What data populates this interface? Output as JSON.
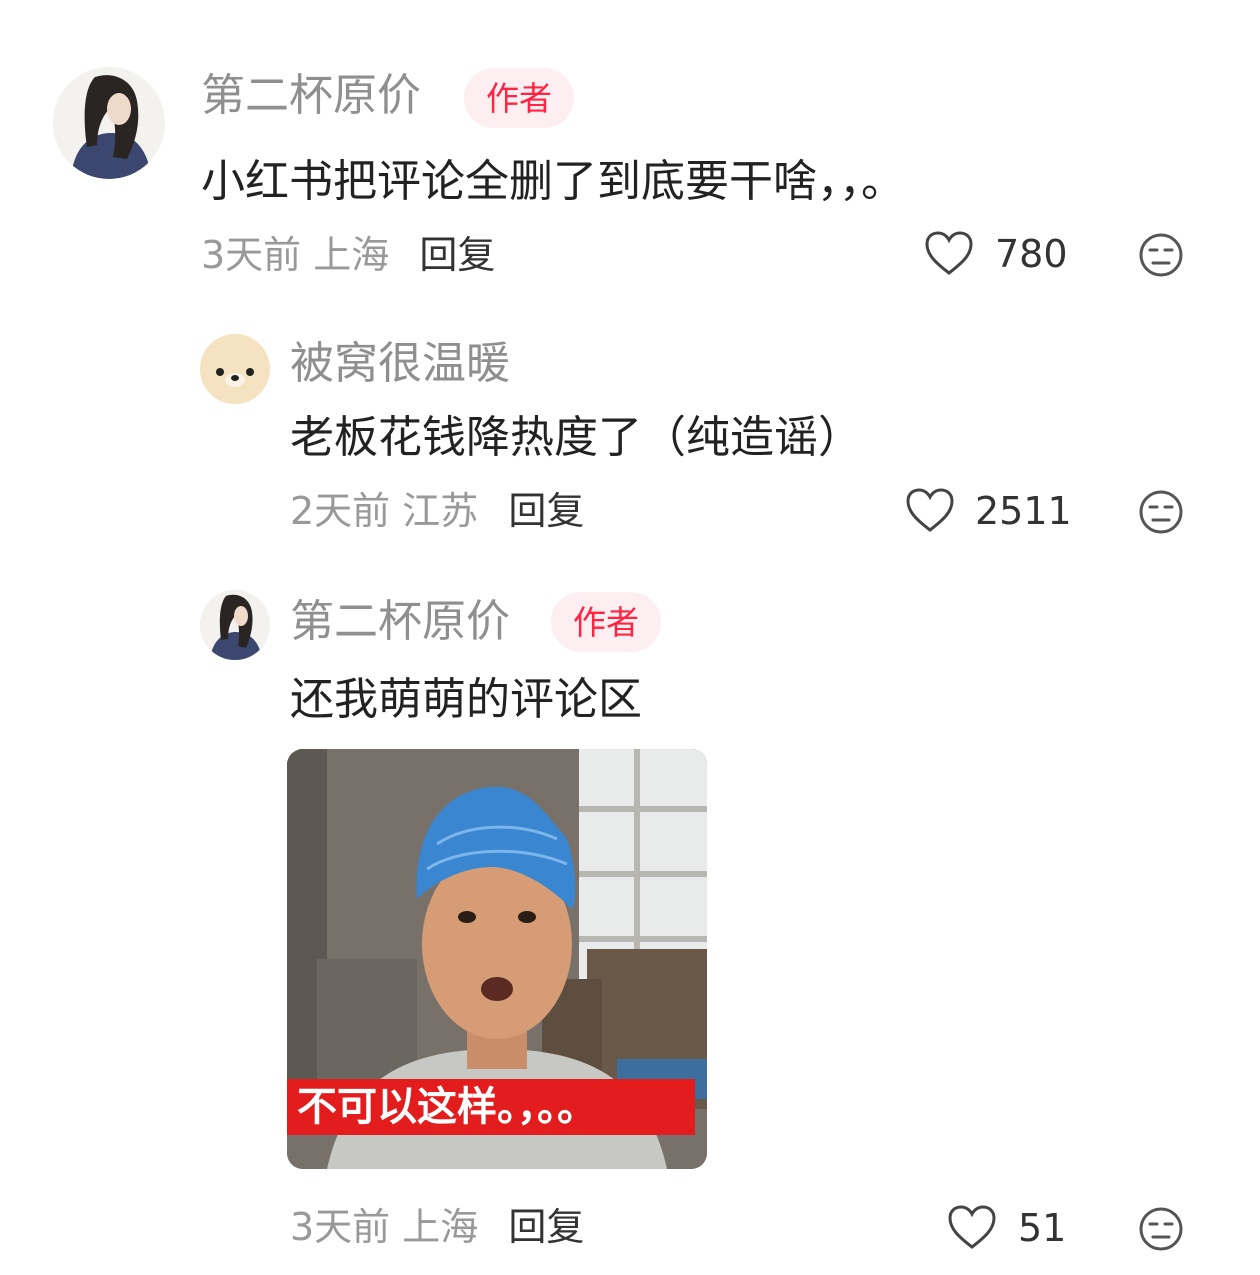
{
  "comments": [
    {
      "author": "第二杯原价",
      "badge": "作者",
      "text": "小红书把评论全删了到底要干啥，，。",
      "time": "3天前",
      "location": "上海",
      "reply_label": "回复",
      "likes": "780"
    },
    {
      "author": "被窝很温暖",
      "text": "老板花钱降热度了（纯造谣）",
      "time": "2天前",
      "location": "江苏",
      "reply_label": "回复",
      "likes": "2511"
    },
    {
      "author": "第二杯原价",
      "badge": "作者",
      "text": "还我萌萌的评论区",
      "image_caption": "不可以这样。，。。",
      "time": "3天前",
      "location": "上海",
      "reply_label": "回复",
      "likes": "51"
    }
  ],
  "icons": {
    "like": "heart-outline-icon",
    "dislike": "neutral-face-icon"
  },
  "colors": {
    "badge_text": "#ff2442",
    "badge_bg": "#fdeff1",
    "meta_text": "#999999",
    "caption_bg": "#e31d1d"
  }
}
